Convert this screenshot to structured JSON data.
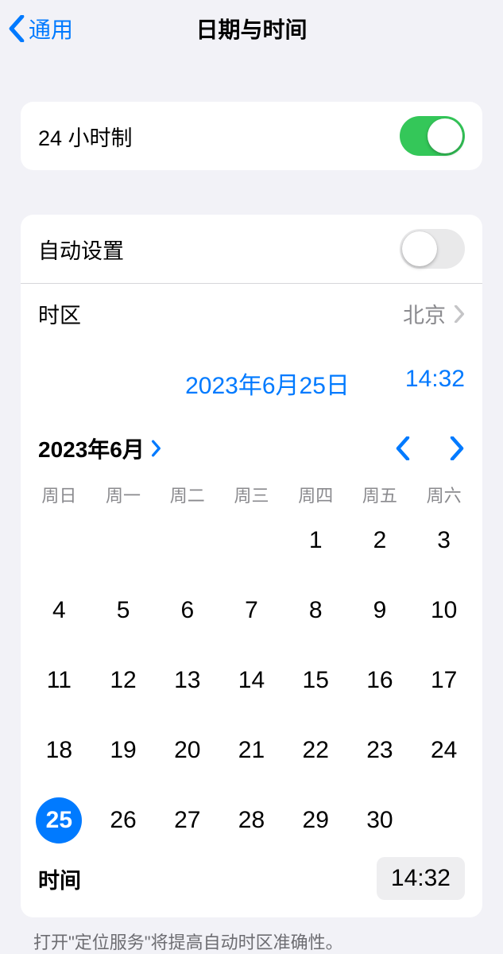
{
  "nav": {
    "back": "通用",
    "title": "日期与时间"
  },
  "group1": {
    "clock24_label": "24 小时制",
    "clock24_on": true
  },
  "group2": {
    "auto_set_label": "自动设置",
    "auto_set_on": false,
    "timezone_label": "时区",
    "timezone_value": "北京",
    "summary_date": "2023年6月25日",
    "summary_time": "14:32"
  },
  "calendar": {
    "month_title": "2023年6月",
    "weekdays": [
      "周日",
      "周一",
      "周二",
      "周三",
      "周四",
      "周五",
      "周六"
    ],
    "leading_blanks": 4,
    "days_in_month": 30,
    "selected_day": 25
  },
  "time_row": {
    "label": "时间",
    "value": "14:32"
  },
  "footnote": "打开\"定位服务\"将提高自动时区准确性。"
}
